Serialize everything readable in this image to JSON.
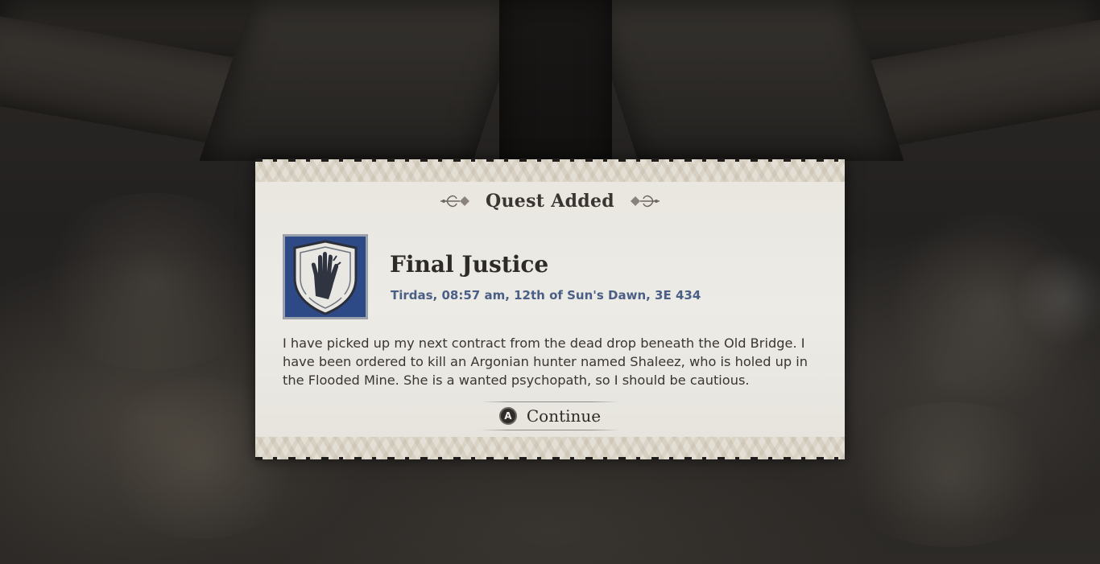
{
  "dialog": {
    "header": "Quest Added",
    "quest_title": "Final Justice",
    "quest_date": "Tirdas, 08:57 am, 12th of Sun's Dawn, 3E 434",
    "description": "I have picked up my next contract from the dead drop beneath the Old Bridge. I have been ordered to kill an Argonian hunter named Shaleez, who is holed up in the Flooded Mine. She is a wanted psychopath, so I should be cautious.",
    "emblem_icon": "dark-brotherhood-hand-icon",
    "continue": {
      "button_glyph": "A",
      "label": "Continue"
    }
  },
  "colors": {
    "parchment": "#ecebe6",
    "title_text": "#2e2a28",
    "date_text": "#4b5f86",
    "emblem_blue": "#2e4a86"
  }
}
